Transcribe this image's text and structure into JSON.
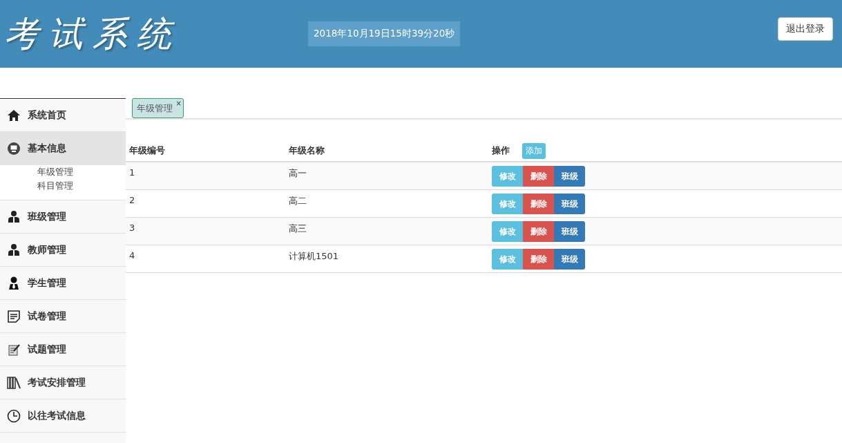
{
  "header": {
    "logo": "考试系统",
    "datetime": "2018年10月19日15时39分20秒",
    "logout_button": "退出登录"
  },
  "sidebar": {
    "items": [
      {
        "label": "系统首页",
        "selected": false
      },
      {
        "label": "基本信息",
        "selected": true,
        "children": [
          {
            "label": "年级管理"
          },
          {
            "label": "科目管理"
          }
        ]
      },
      {
        "label": "班级管理",
        "selected": false
      },
      {
        "label": "教师管理",
        "selected": false
      },
      {
        "label": "学生管理",
        "selected": false
      },
      {
        "label": "试卷管理",
        "selected": false
      },
      {
        "label": "试题管理",
        "selected": false
      },
      {
        "label": "考试安排管理",
        "selected": false
      },
      {
        "label": "以往考试信息",
        "selected": false
      }
    ]
  },
  "tabs": [
    {
      "label": "年级管理",
      "close": "×",
      "selected": true
    }
  ],
  "table": {
    "columns": [
      "年级编号",
      "年级名称",
      "操作"
    ],
    "add_button": "添加",
    "rows": [
      {
        "cells": [
          "1",
          "高一"
        ],
        "actions": [
          {
            "kind": "edit",
            "label": "修改"
          },
          {
            "kind": "delete",
            "label": "删除"
          },
          {
            "kind": "class",
            "label": "班级"
          }
        ]
      },
      {
        "cells": [
          "2",
          "高二"
        ],
        "actions": [
          {
            "kind": "edit",
            "label": "修改"
          },
          {
            "kind": "delete",
            "label": "删除"
          },
          {
            "kind": "class",
            "label": "班级"
          }
        ]
      },
      {
        "cells": [
          "3",
          "高三"
        ],
        "actions": [
          {
            "kind": "edit",
            "label": "修改"
          },
          {
            "kind": "delete",
            "label": "删除"
          },
          {
            "kind": "class",
            "label": "班级"
          }
        ]
      },
      {
        "cells": [
          "4",
          "计算机1501"
        ],
        "actions": [
          {
            "kind": "edit",
            "label": "修改"
          },
          {
            "kind": "delete",
            "label": "删除"
          },
          {
            "kind": "class",
            "label": "班级"
          }
        ]
      }
    ]
  }
}
